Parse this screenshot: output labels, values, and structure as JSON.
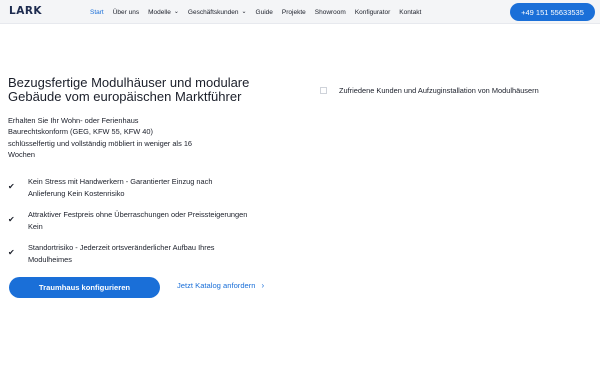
{
  "header": {
    "logo": "LARK",
    "nav": [
      {
        "label": "Start",
        "active": true,
        "dropdown": false
      },
      {
        "label": "Über uns",
        "active": false,
        "dropdown": false
      },
      {
        "label": "Modelle",
        "active": false,
        "dropdown": true
      },
      {
        "label": "Geschäftskunden",
        "active": false,
        "dropdown": true
      },
      {
        "label": "Guide",
        "active": false,
        "dropdown": false
      },
      {
        "label": "Projekte",
        "active": false,
        "dropdown": false
      },
      {
        "label": "Showroom",
        "active": false,
        "dropdown": false
      },
      {
        "label": "Konfigurator",
        "active": false,
        "dropdown": false
      },
      {
        "label": "Kontakt",
        "active": false,
        "dropdown": false
      }
    ],
    "phone": "+49 151 55633535"
  },
  "hero": {
    "headline_line1": "Bezugsfertige Modulhäuser und modulare",
    "headline_line2": "Gebäude vom europäischen Marktführer",
    "sub_line1": "Erhalten Sie Ihr Wohn- oder Ferienhaus",
    "sub_line2": "Baurechtskonform (GEG, KFW 55, KFW 40)",
    "sub_line3": "schlüsselfertig und vollständig möbliert in weniger als 16",
    "sub_line4": "Wochen",
    "features": [
      {
        "line1": "Kein Stress mit Handwerkern - Garantierter Einzug nach",
        "line2": "Anlieferung Kein Kostenrisiko"
      },
      {
        "line1": "Attraktiver Festpreis ohne Überraschungen oder Preissteigerungen",
        "line2": "Kein"
      },
      {
        "line1": "Standortrisiko - Jederzeit ortsveränderlicher Aufbau Ihres",
        "line2": "Modulheimes"
      }
    ],
    "check_glyph": "✔",
    "cta_label": "Traumhaus konfigurieren",
    "catalog_label": "Jetzt Katalog anfordern",
    "arrow_glyph": "›",
    "image_alt": "Zufriedene Kunden und Aufzuginstallation von Modulhäusern"
  },
  "colors": {
    "accent": "#1a6fd8",
    "text": "#1b1f2a",
    "header_bg": "#f4f5f7"
  },
  "icons": {
    "check": "check-icon",
    "chevron": "chevron-down-icon",
    "arrow": "chevron-right-icon",
    "broken_image": "broken-image-icon"
  }
}
